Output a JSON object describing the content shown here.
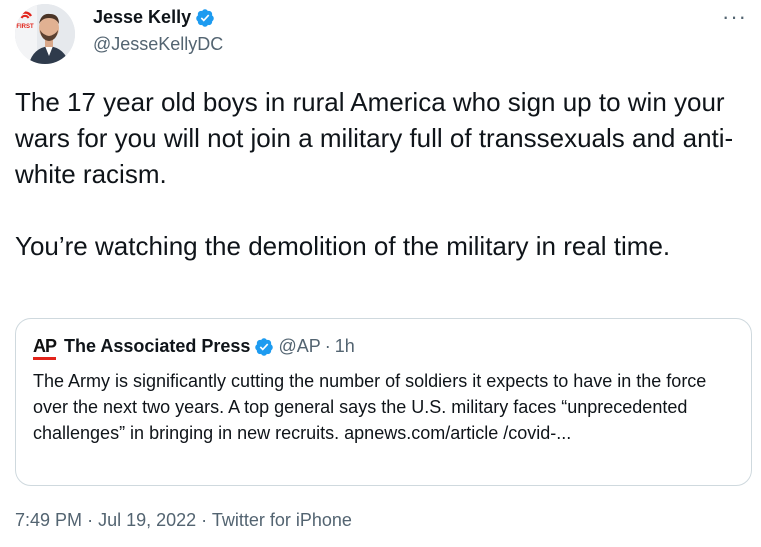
{
  "author": {
    "display_name": "Jesse Kelly",
    "handle": "@JesseKellyDC",
    "avatar_logo_text": "FIRST"
  },
  "more_label": "···",
  "tweet": {
    "paragraphs": [
      "The 17 year old boys in rural America who sign up to win your wars for you will not join a military full of transsexuals and anti-white racism.",
      "You’re watching the demolition of the military in real time."
    ]
  },
  "quote": {
    "logo_text": "AP",
    "display_name": "The Associated Press",
    "handle": "@AP",
    "separator": "·",
    "time": "1h",
    "text": "The Army is significantly cutting the number of soldiers it expects to have in the force over the next two years. A top general says the U.S. military faces “unprecedented challenges”  in bringing in new recruits. apnews.com/article /covid-..."
  },
  "footer": {
    "time": "7:49 PM",
    "date": "Jul 19, 2022",
    "source": "Twitter for iPhone",
    "separator": "·"
  },
  "colors": {
    "text": "#0f1419",
    "secondary": "#536471",
    "verified": "#1d9bf0",
    "border": "#cfd9de",
    "ap_red": "#e2231a"
  }
}
